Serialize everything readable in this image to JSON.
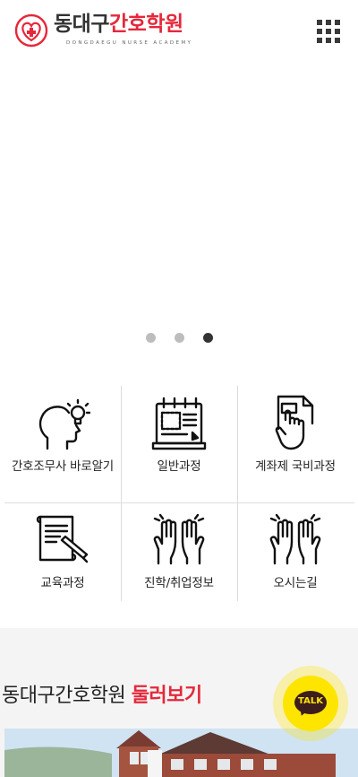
{
  "header": {
    "logo_dark": "동대구",
    "logo_red": "간호학원",
    "logo_sub": "DONGDAEGU NURSE ACADEMY",
    "menu_icon": "grid-menu-icon"
  },
  "slider": {
    "slide_count": 3,
    "active_index": 2
  },
  "quick_menu": [
    {
      "label": "간호조무사 바로알기",
      "icon": "head-lightbulb-icon"
    },
    {
      "label": "일반과정",
      "icon": "notebook-icon"
    },
    {
      "label": "계좌제 국비과정",
      "icon": "hand-document-icon"
    },
    {
      "label": "교육과정",
      "icon": "document-pencil-icon"
    },
    {
      "label": "진학/취업정보",
      "icon": "clapping-hands-icon"
    },
    {
      "label": "오시는길",
      "icon": "clapping-hands-icon"
    }
  ],
  "gallery": {
    "title_normal": "동대구간호학원",
    "title_bold": "둘러보기"
  },
  "kakao": {
    "label": "TALK",
    "icon": "kakao-talk-icon"
  },
  "colors": {
    "brand_red": "#e5283b",
    "kakao_yellow": "#fee500",
    "text_dark": "#222222"
  }
}
